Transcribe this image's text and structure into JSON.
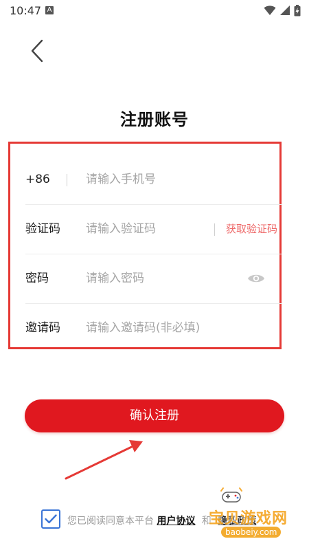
{
  "status_bar": {
    "time": "10:47",
    "notification_icon_text": "A",
    "icons": [
      "wifi-icon",
      "signal-icon",
      "battery-icon"
    ]
  },
  "header": {
    "back_icon": "chevron-left-icon",
    "title": "注册账号"
  },
  "form": {
    "phone": {
      "prefix": "+86",
      "placeholder": "请输入手机号",
      "value": ""
    },
    "verification": {
      "label": "验证码",
      "placeholder": "请输入验证码",
      "value": "",
      "get_code_label": "获取验证码"
    },
    "password": {
      "label": "密码",
      "placeholder": "请输入密码",
      "value": "",
      "toggle_icon": "eye-icon"
    },
    "invite": {
      "label": "邀请码",
      "placeholder": "请输入邀请码(非必填)",
      "value": ""
    }
  },
  "submit": {
    "label": "确认注册"
  },
  "agreement": {
    "checked": true,
    "text": "您已阅读同意本平台",
    "user_agreement": "用户协议",
    "and": "和",
    "privacy_policy": "隐私政策"
  },
  "watermark": {
    "title": "宝贝游戏网",
    "url": "baobeiy.com"
  },
  "colors": {
    "accent_red": "#e0181f",
    "highlight_border": "#e53935",
    "get_code_text": "#ee6a6a",
    "checkbox_blue": "#3a74d6",
    "watermark_orange": "#f5a623"
  }
}
